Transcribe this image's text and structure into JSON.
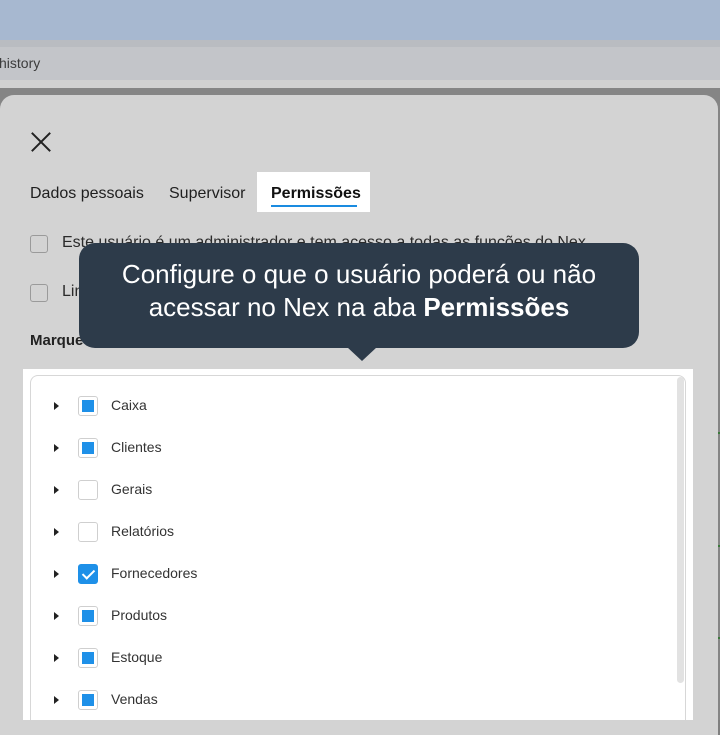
{
  "browser": {
    "history_label": "history"
  },
  "dialog": {
    "tabs": [
      {
        "label": "Dados pessoais",
        "active": false
      },
      {
        "label": "Supervisor",
        "active": false
      },
      {
        "label": "Permissões",
        "active": true
      }
    ],
    "options": [
      {
        "label": "Este usuário é um administrador e tem acesso a todas as funções do Nex",
        "checked": false
      },
      {
        "label": "Lim",
        "checked": false
      }
    ],
    "section_label": "Marque"
  },
  "tooltip": {
    "line1": "Configure o que o usuário poderá ou não",
    "line2_prefix": "acessar no Nex na aba",
    "line2_bold": "Permissões"
  },
  "permissions": [
    {
      "label": "Caixa",
      "state": "partial"
    },
    {
      "label": "Clientes",
      "state": "partial"
    },
    {
      "label": "Gerais",
      "state": "unchecked"
    },
    {
      "label": "Relatórios",
      "state": "unchecked"
    },
    {
      "label": "Fornecedores",
      "state": "checked"
    },
    {
      "label": "Produtos",
      "state": "partial"
    },
    {
      "label": "Estoque",
      "state": "partial"
    },
    {
      "label": "Vendas",
      "state": "partial"
    }
  ],
  "colors": {
    "accent": "#1e90e8",
    "tooltip_bg": "#2d3b4a",
    "tab_underline": "#1a8be0"
  }
}
